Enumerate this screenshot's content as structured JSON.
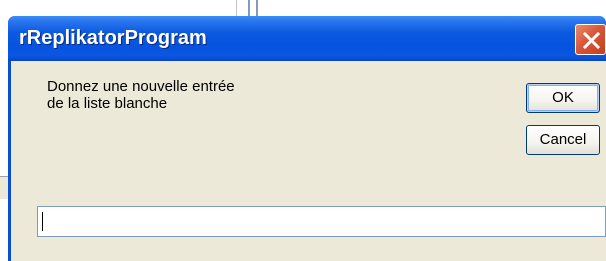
{
  "dialog": {
    "title": "rReplikatorProgram",
    "prompt": "Donnez une nouvelle entrée\nde la liste blanche",
    "ok_label": "OK",
    "cancel_label": "Cancel",
    "input": {
      "value": "",
      "placeholder": ""
    }
  },
  "colors": {
    "titlebar": "#0553df",
    "client_background": "#ece9d8",
    "close_button": "#d9573a",
    "button_border": "#003c74"
  },
  "icons": {
    "close": "close-icon"
  }
}
